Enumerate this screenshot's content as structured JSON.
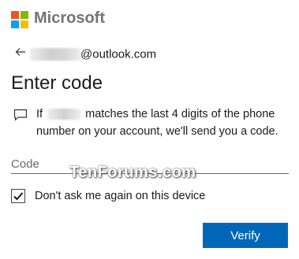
{
  "brand": {
    "name": "Microsoft",
    "logo_colors": [
      "#f25022",
      "#7fba00",
      "#00a4ef",
      "#ffb900"
    ]
  },
  "account": {
    "email_suffix": "@outlook.com"
  },
  "page": {
    "title": "Enter code"
  },
  "message": {
    "prefix": "If",
    "text": "matches the last 4 digits of the phone number on your account, we'll send you a code."
  },
  "code_field": {
    "placeholder": "Code",
    "value": ""
  },
  "remember": {
    "label": "Don't ask me again on this device",
    "checked": true
  },
  "actions": {
    "verify_label": "Verify"
  },
  "watermark": {
    "text": "TenForums.com"
  },
  "colors": {
    "accent": "#0067b8"
  },
  "icons": [
    "back-arrow-icon",
    "message-icon",
    "checkmark-icon"
  ]
}
